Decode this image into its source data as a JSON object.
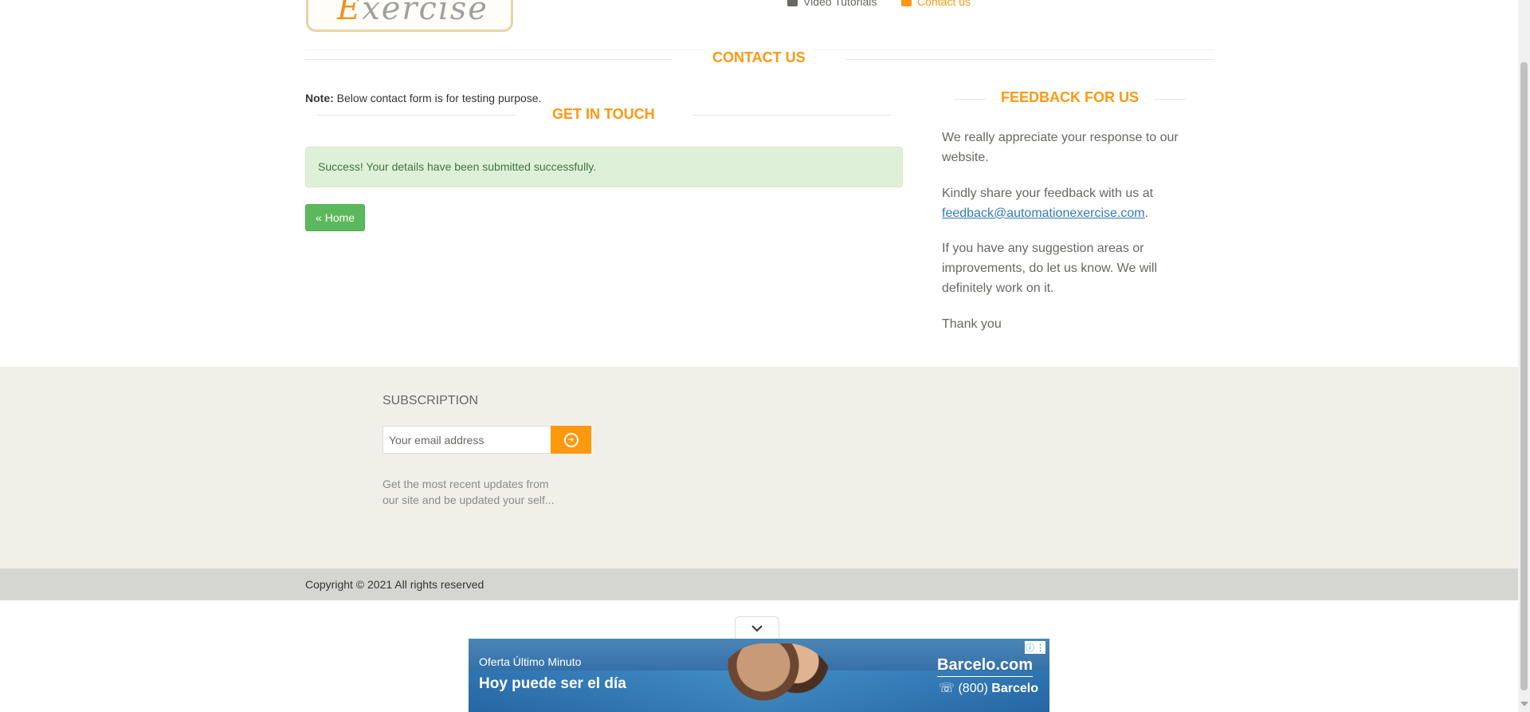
{
  "header": {
    "logo_text": "Exercise",
    "logo_first_letter": "E",
    "logo_rest": "xercise",
    "nav_video": "Video Tutorials",
    "nav_contact": "Contact us"
  },
  "contact": {
    "title": "Contact Us",
    "note_label": "Note:",
    "note_text": " Below contact form is for testing purpose.",
    "get_in_touch": "Get In Touch",
    "success_message": "Success! Your details have been submitted successfully.",
    "home_button": "Home"
  },
  "feedback": {
    "title": "Feedback For Us",
    "p1": "We really appreciate your response to our website.",
    "p2_prefix": "Kindly share your feedback with us at ",
    "email": "feedback@automationexercise.com",
    "p2_suffix": ".",
    "p3": "If you have any suggestion areas or improvements, do let us know. We will definitely work on it.",
    "p4": "Thank you"
  },
  "subscription": {
    "title": "Subscription",
    "placeholder": "Your email address",
    "help": "Get the most recent updates from our site and be updated your self..."
  },
  "footer": {
    "copyright": "Copyright © 2021 All rights reserved"
  },
  "ad": {
    "line1": "Oferta Último Minuto",
    "line2": "Hoy puede ser el día",
    "brand": "Barcelo.com",
    "phone_prefix": "(800)",
    "phone_brand": "Barcelo"
  },
  "colors": {
    "accent": "#FE980F",
    "success_bg": "#dff0d8",
    "success_text": "#3c763d",
    "home_button": "#5cb85c",
    "footer_bg": "#f0f0e9",
    "footer_bottom_bg": "#d6d6d0"
  }
}
